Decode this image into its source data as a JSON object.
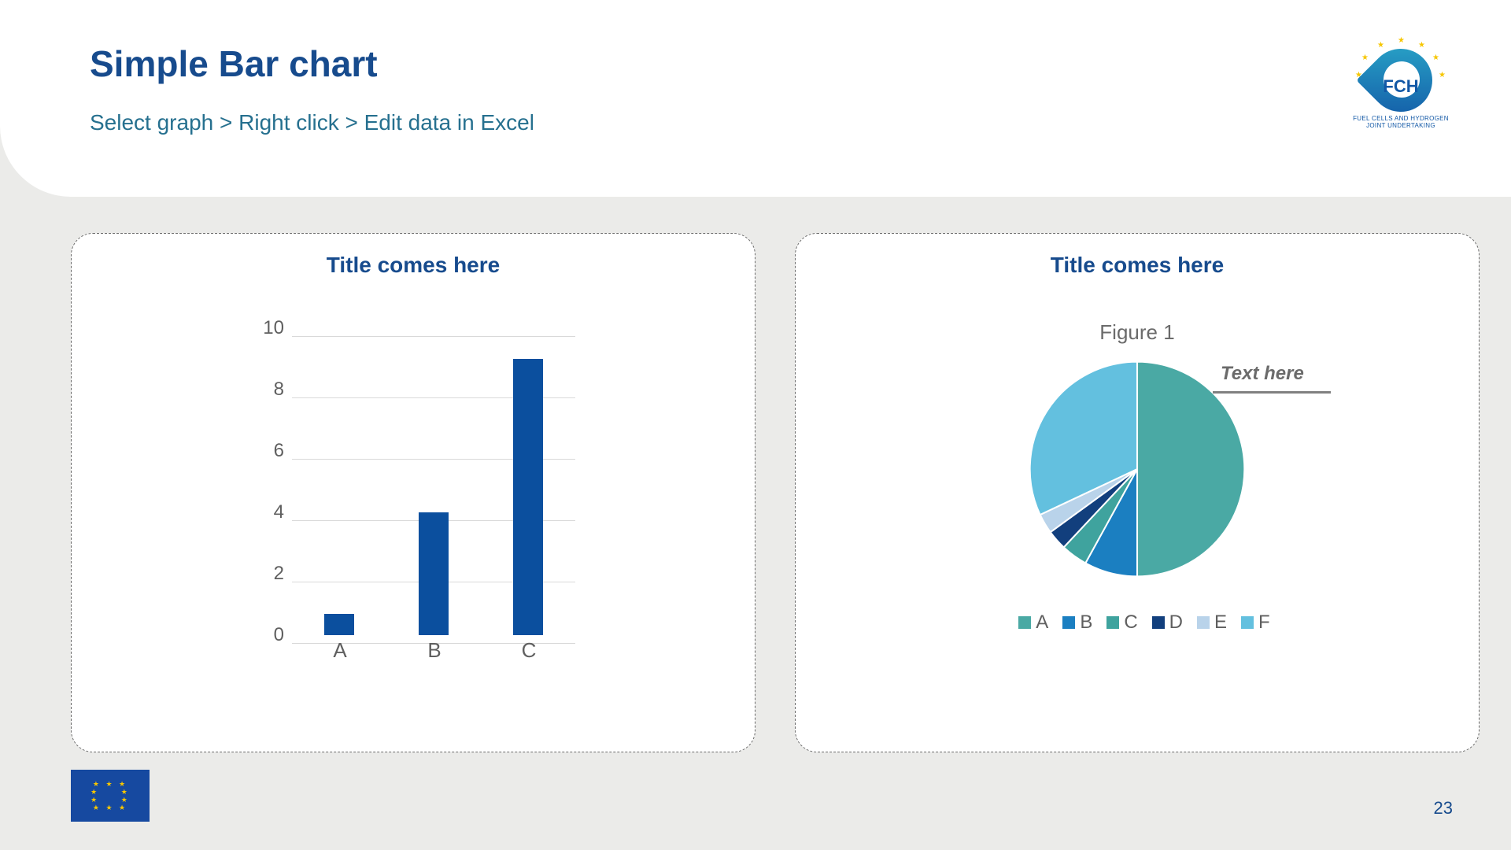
{
  "header": {
    "title": "Simple Bar chart",
    "subtitle": "Select graph > Right click > Edit data in Excel",
    "logo_text": "FCH",
    "logo_ring": "FUEL CELLS AND HYDROGEN JOINT UNDERTAKING"
  },
  "panels": {
    "bar": {
      "title": "Title comes here"
    },
    "pie": {
      "title": "Title comes here",
      "figure_label": "Figure 1",
      "annotation": "Text here"
    }
  },
  "footer": {
    "page_number": "23"
  },
  "chart_data": [
    {
      "type": "bar",
      "title": "Title comes here",
      "categories": [
        "A",
        "B",
        "C"
      ],
      "values": [
        0.7,
        4,
        9
      ],
      "xlabel": "",
      "ylabel": "",
      "ylim": [
        0,
        10
      ],
      "yticks": [
        0,
        2,
        4,
        6,
        8,
        10
      ],
      "bar_color": "#0b4f9e"
    },
    {
      "type": "pie",
      "title": "Title comes here",
      "subtitle": "Figure 1",
      "annotation": "Text here",
      "series": [
        {
          "name": "A",
          "value": 50,
          "color": "#4aa9a4"
        },
        {
          "name": "B",
          "value": 8,
          "color": "#1b7fc1"
        },
        {
          "name": "C",
          "value": 4,
          "color": "#3fa39e"
        },
        {
          "name": "D",
          "value": 3,
          "color": "#123f7d"
        },
        {
          "name": "E",
          "value": 3,
          "color": "#b9d3ea"
        },
        {
          "name": "F",
          "value": 32,
          "color": "#63c0df"
        }
      ]
    }
  ]
}
